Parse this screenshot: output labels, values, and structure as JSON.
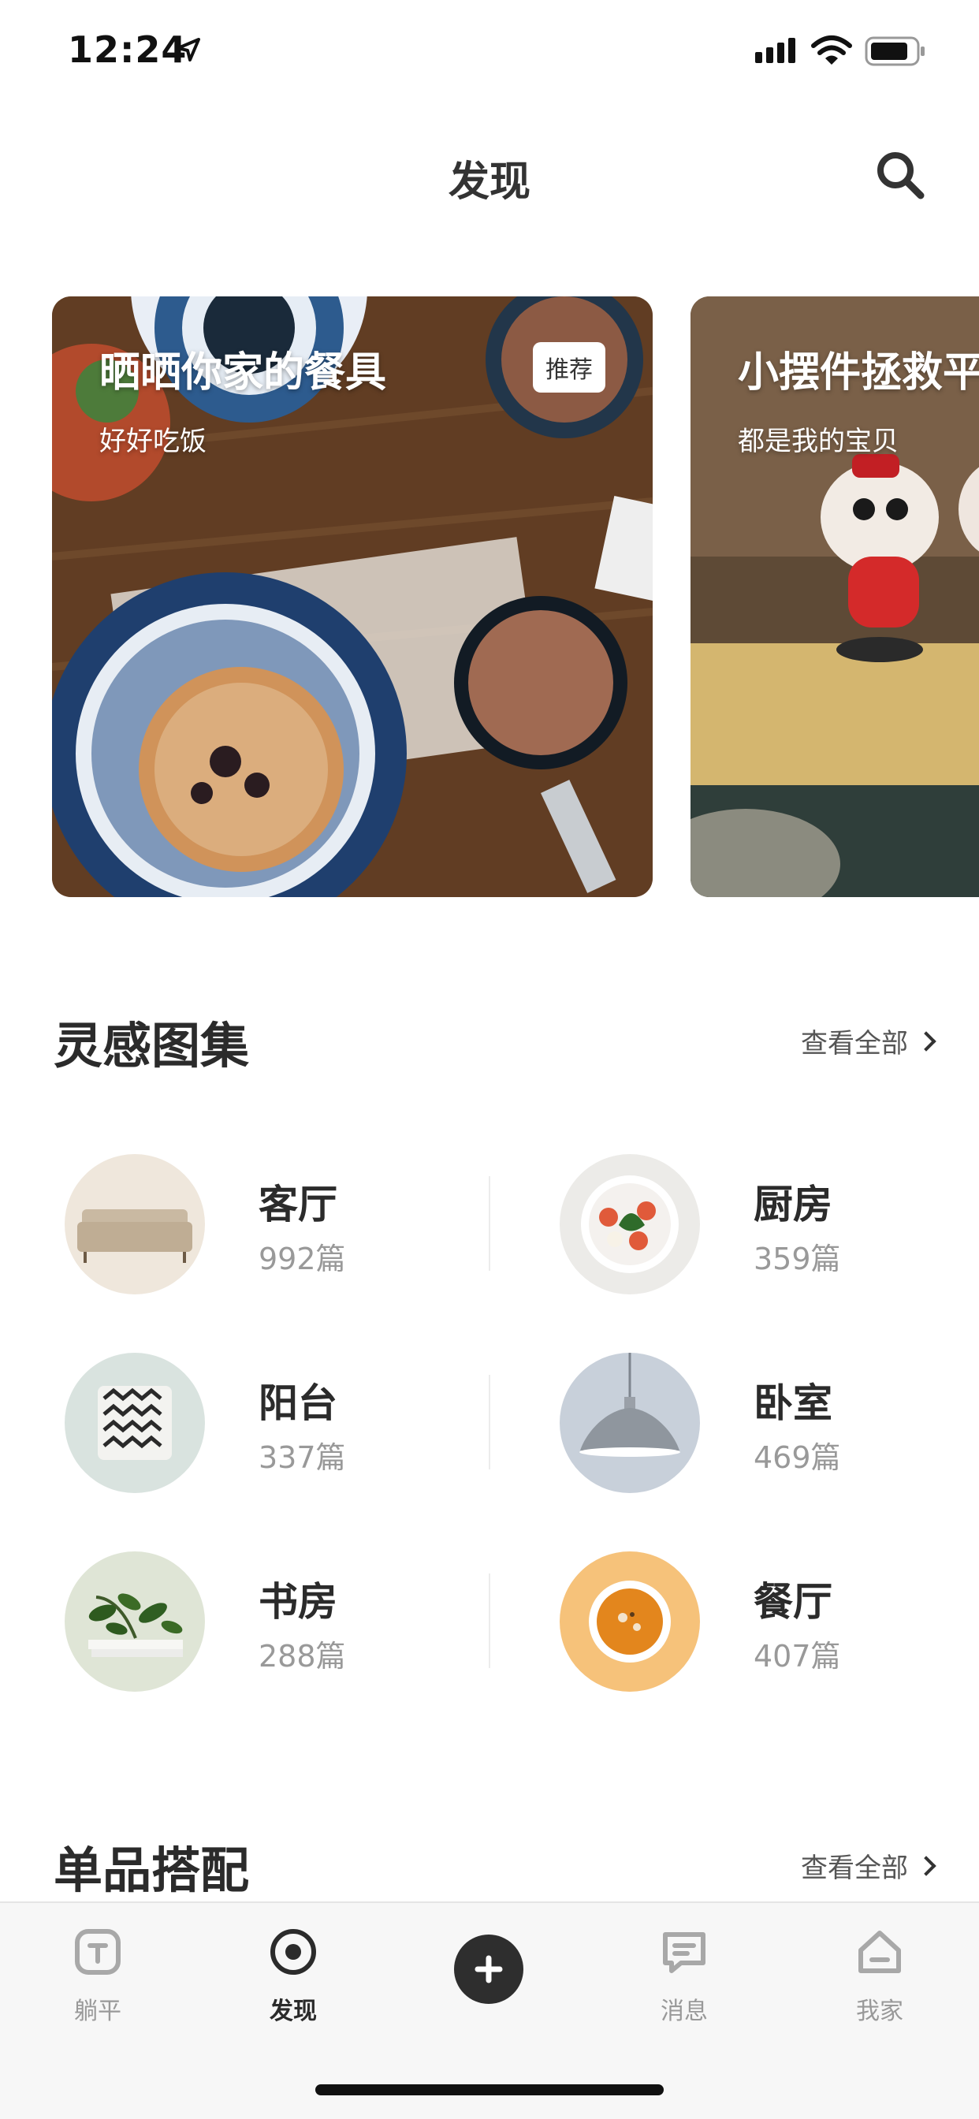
{
  "status_bar": {
    "time": "12:24"
  },
  "header": {
    "title": "发现"
  },
  "banners": [
    {
      "title": "晒晒你家的餐具",
      "subtitle": "好好吃饭",
      "badge": "推荐"
    },
    {
      "title": "小摆件拯救平",
      "subtitle": "都是我的宝贝"
    }
  ],
  "inspiration": {
    "title": "灵感图集",
    "more_label": "查看全部",
    "items": [
      {
        "name": "客厅",
        "count": "992篇"
      },
      {
        "name": "厨房",
        "count": "359篇"
      },
      {
        "name": "阳台",
        "count": "337篇"
      },
      {
        "name": "卧室",
        "count": "469篇"
      },
      {
        "name": "书房",
        "count": "288篇"
      },
      {
        "name": "餐厅",
        "count": "407篇"
      }
    ]
  },
  "products": {
    "title": "单品搭配",
    "more_label": "查看全部"
  },
  "tab_bar": {
    "items": [
      {
        "label": "躺平",
        "icon": "tangping-icon"
      },
      {
        "label": "发现",
        "icon": "discover-icon"
      },
      {
        "label": "",
        "icon": "plus-icon"
      },
      {
        "label": "消息",
        "icon": "message-icon"
      },
      {
        "label": "我家",
        "icon": "home-icon"
      }
    ],
    "active": "发现"
  }
}
